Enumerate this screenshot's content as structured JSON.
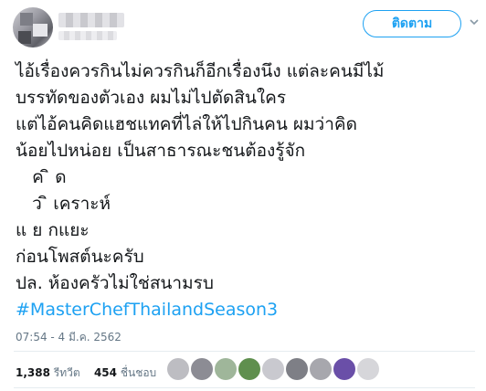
{
  "header": {
    "follow_label": "ติดตาม"
  },
  "tweet": {
    "lines": [
      "ไอ้เรื่องควรกินไม่ควรกินก็อีกเรื่องนึง แต่ละคนมีไม้",
      "บรรทัดของตัวเอง ผมไม่ไปตัดสินใคร",
      "แต่ไอ้คนคิดแฮชแทคที่ไล่ให้ไปกินคน ผมว่าคิด",
      "น้อยไปหน่อย เป็นสาธารณะชนต้องรู้จัก",
      "   ค ิ ด",
      "   ว ิ เคราะห์",
      "แ ย กแยะ",
      "ก่อนโพสต์นะครับ",
      "ปล. ห้องครัวไม่ใช่สนามรบ"
    ],
    "hashtag": "#MasterChefThailandSeason3"
  },
  "meta": {
    "timestamp": "07:54 - 4 มี.ค. 2562"
  },
  "stats": {
    "retweets_count": "1,388",
    "retweets_label": "รีทวีต",
    "likes_count": "454",
    "likes_label": "ชื่นชอบ"
  },
  "colors": {
    "accent": "#1da1f2",
    "text": "#14171a",
    "muted": "#657786"
  }
}
